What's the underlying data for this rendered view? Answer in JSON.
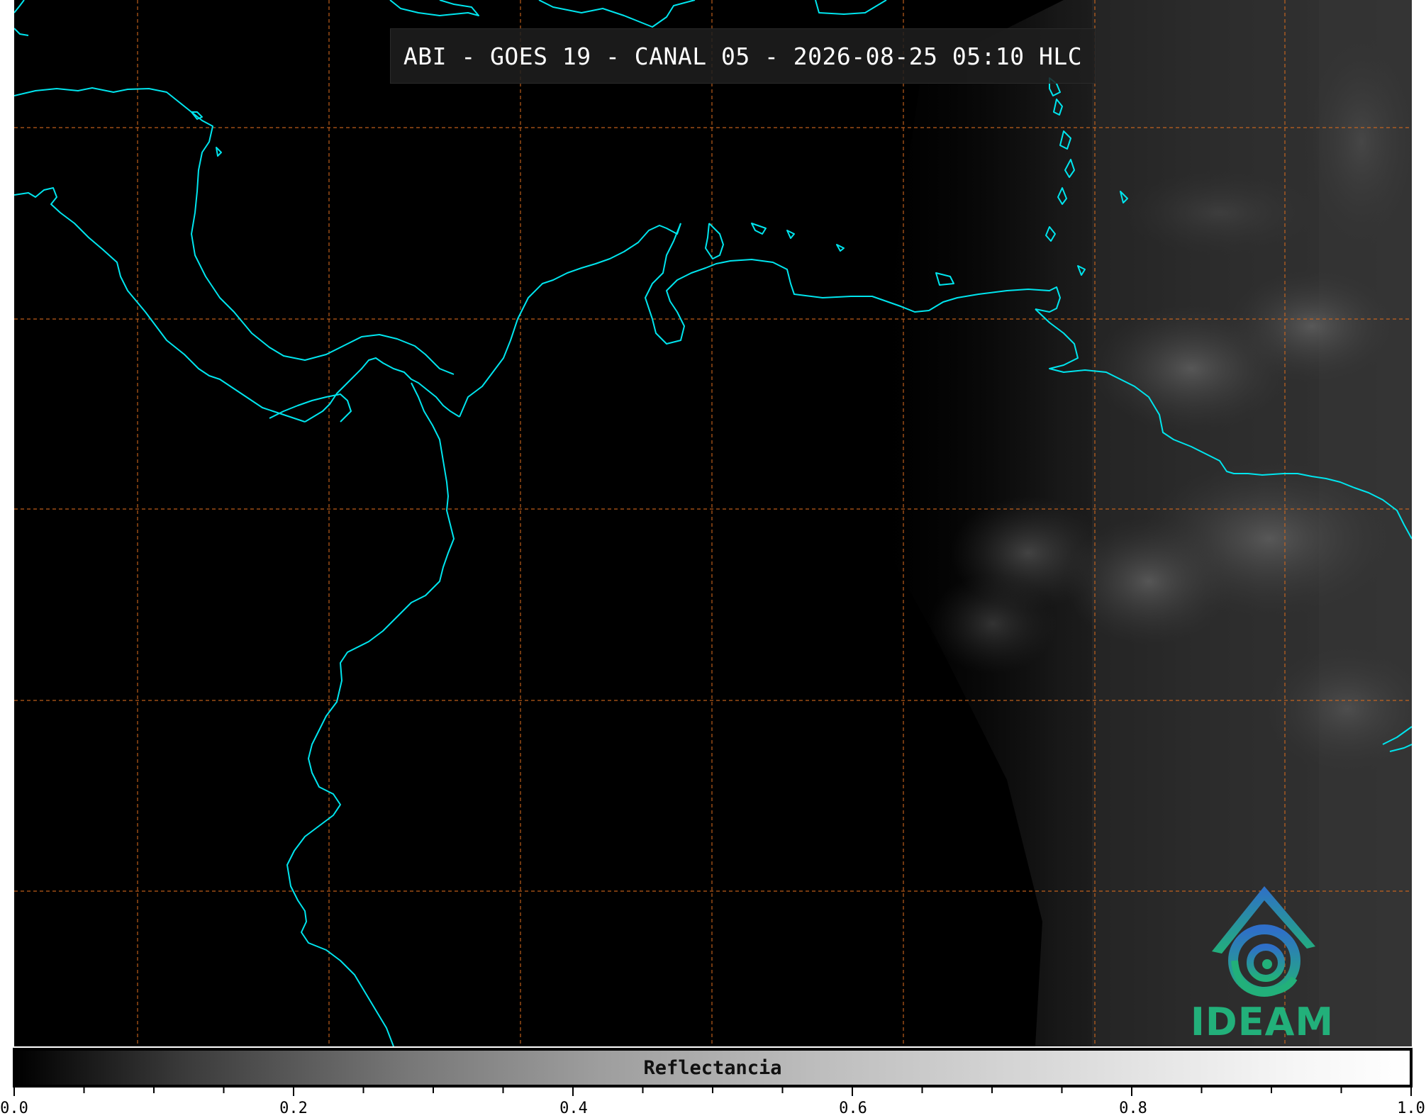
{
  "title": "ABI - GOES 19 - CANAL 05 - 2026-08-25 05:10 HLC",
  "logo": {
    "text": "IDEAM",
    "icon": "ideam-mountain-swirl-logo",
    "colors": {
      "top": "#2f7ec9",
      "bottom": "#22b07a"
    }
  },
  "colorbar": {
    "label": "Reflectancia",
    "colormap": "grayscale",
    "range": [
      0.0,
      1.0
    ],
    "tick_labels": [
      "0.0",
      "0.2",
      "0.4",
      "0.6",
      "0.8",
      "1.0"
    ],
    "minor_tick_step": 0.05
  },
  "map": {
    "coastline_color": "#00e5ee",
    "gridline_color": "#d2691e",
    "gridline_style": "dashed",
    "background": "#000000"
  }
}
